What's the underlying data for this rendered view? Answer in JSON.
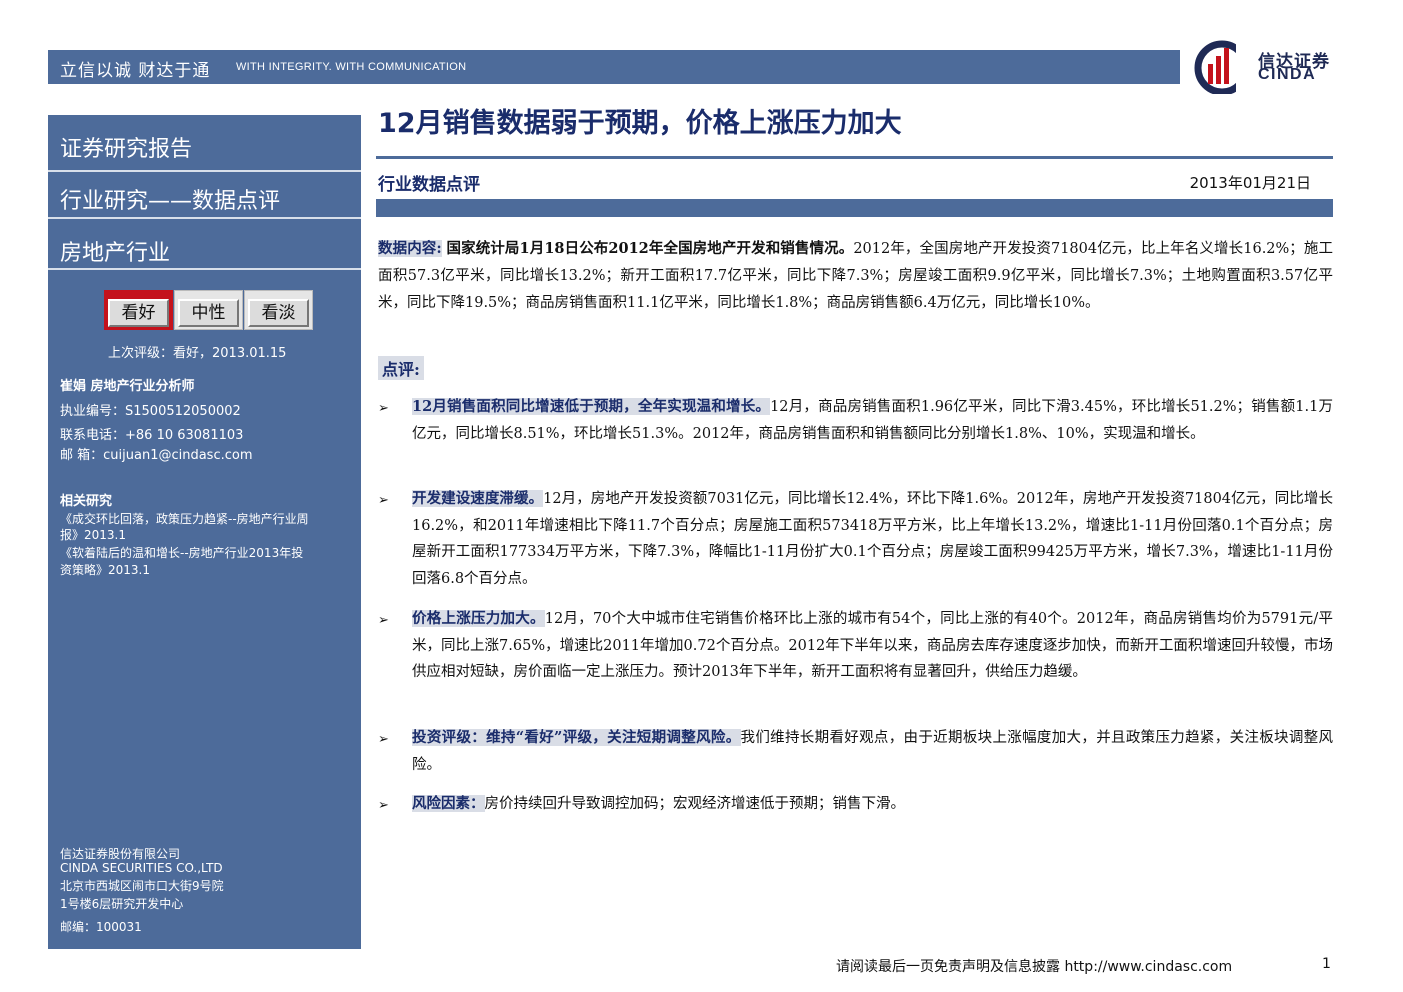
{
  "header": {
    "slogan_cn": "立信以诚  财达于通",
    "slogan_en": "WITH INTEGRITY. WITH COMMUNICATION",
    "logo_cn": "信达证券",
    "logo_en": "CINDA",
    "logo_colors": {
      "navy": "#1f2a55",
      "red": "#c4121c"
    }
  },
  "sidebar": {
    "titles": [
      "证券研究报告",
      "行业研究——数据点评",
      "房地产行业"
    ],
    "ratings": [
      {
        "label": "看好",
        "active": true
      },
      {
        "label": "中性",
        "active": false
      },
      {
        "label": "看淡",
        "active": false
      }
    ],
    "last_rating": "上次评级：看好，2013.01.15",
    "analyst_line": "崔娟     房地产行业分析师",
    "cert": "执业编号：S1500512050002",
    "phone": "联系电话：+86 10 63081103",
    "email": "邮    箱：cuijuan1@cindasc.com",
    "related_heading": "相关研究",
    "related_1a": "《成交环比回落，政策压力趋紧--房地产行业周",
    "related_1b": "报》2013.1",
    "related_2a": "《软着陆后的温和增长--房地产行业2013年投",
    "related_2b": "资策略》2013.1",
    "company_cn": "信达证券股份有限公司",
    "company_en": "CINDA SECURITIES CO.,LTD",
    "address_1": "北京市西城区闹市口大街9号院",
    "address_2": "1号楼6层研究开发中心",
    "postcode": "邮编：100031"
  },
  "main": {
    "title": "12月销售数据弱于预期，价格上涨压力加大",
    "subtitle": "行业数据点评",
    "date": "2013年01月21日",
    "data_label": "数据内容:",
    "data_lead": "国家统计局1月18日公布2012年全国房地产开发和销售情况。",
    "data_text": "2012年，全国房地产开发投资71804亿元，比上年名义增长16.2%；施工面积57.3亿平米，同比增长13.2%；新开工面积17.7亿平米，同比下降7.3%；房屋竣工面积9.9亿平米，同比增长7.3%；土地购置面积3.57亿平米，同比下降19.5%；商品房销售面积11.1亿平米，同比增长1.8%；商品房销售额6.4万亿元，同比增长10%。",
    "comment_label": "点评:",
    "bullets": [
      {
        "head": "12月销售面积同比增速低于预期，全年实现温和增长。",
        "text": "12月，商品房销售面积1.96亿平米，同比下滑3.45%，环比增长51.2%；销售额1.1万亿元，同比增长8.51%，环比增长51.3%。2012年，商品房销售面积和销售额同比分别增长1.8%、10%，实现温和增长。"
      },
      {
        "head": "开发建设速度滞缓。",
        "text": "12月，房地产开发投资额7031亿元，同比增长12.4%，环比下降1.6%。2012年，房地产开发投资71804亿元，同比增长16.2%，和2011年增速相比下降11.7个百分点；房屋施工面积573418万平方米，比上年增长13.2%，增速比1-11月份回落0.1个百分点；房屋新开工面积177334万平方米，下降7.3%，降幅比1-11月份扩大0.1个百分点；房屋竣工面积99425万平方米，增长7.3%，增速比1-11月份回落6.8个百分点。"
      },
      {
        "head": "价格上涨压力加大。",
        "text": "12月，70个大中城市住宅销售价格环比上涨的城市有54个，同比上涨的有40个。2012年，商品房销售均价为5791元/平米，同比上涨7.65%，增速比2011年增加0.72个百分点。2012年下半年以来，商品房去库存速度逐步加快，而新开工面积增速回升较慢，市场供应相对短缺，房价面临一定上涨压力。预计2013年下半年，新开工面积将有显著回升，供给压力趋缓。"
      },
      {
        "head": "投资评级：维持“看好”评级，关注短期调整风险。",
        "text": "我们维持长期看好观点，由于近期板块上涨幅度加大，并且政策压力趋紧，关注板块调整风险。"
      },
      {
        "head": "风险因素：",
        "text": "房价持续回升导致调控加码；宏观经济增速低于预期；销售下滑。"
      }
    ],
    "bullet_glyph": "➢"
  },
  "footer": {
    "notice": "请阅读最后一页免责声明及信息披露  http://www.cindasc.com",
    "page": "1"
  }
}
